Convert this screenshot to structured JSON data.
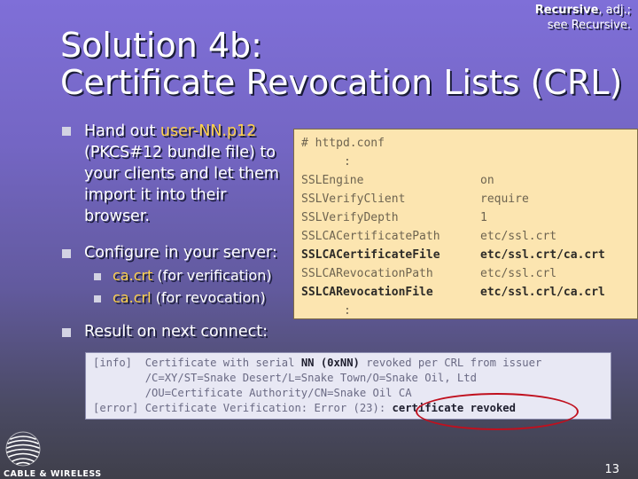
{
  "quote": {
    "word": "Recursive",
    "suffix": ", adj.;",
    "line2": "see Recursive."
  },
  "title": {
    "line1": "Solution 4b:",
    "line2": "Certificate Revocation Lists (CRL)"
  },
  "bullets": {
    "b1": {
      "prefix": "Hand out ",
      "highlight": "user-NN.p12",
      "l2": "(PKCS#12 bundle file) to",
      "l3": "your clients and let them",
      "l4": "import it into their",
      "l5": "browser."
    },
    "b2": {
      "text": "Configure in your server:"
    },
    "sub1": {
      "file": "ca.crt",
      "note": " (for verification)"
    },
    "sub2": {
      "file": "ca.crl",
      "note": " (for revocation)"
    },
    "b3": {
      "text": "Result on next connect:"
    }
  },
  "config": {
    "header": "# httpd.conf",
    "ellipsis": ":",
    "rows": [
      {
        "key": "SSLEngine",
        "value": "on"
      },
      {
        "key": "SSLVerifyClient",
        "value": "require"
      },
      {
        "key": "SSLVerifyDepth",
        "value": "1"
      },
      {
        "key": "SSLCACertificatePath",
        "value": "etc/ssl.crt"
      },
      {
        "key": "SSLCACertificateFile",
        "value": "etc/ssl.crt/ca.crt"
      },
      {
        "key": "SSLCARevocationPath",
        "value": "etc/ssl.crl"
      },
      {
        "key": "SSLCARevocationFile",
        "value": "etc/ssl.crl/ca.crl"
      }
    ]
  },
  "log": {
    "l1_tag": "[info]  ",
    "l1_a": "Certificate with serial ",
    "l1_nn": "NN",
    "l1_sp": " ",
    "l1_hex": "(0xNN)",
    "l1_b": " revoked per CRL from issuer",
    "l2": "        /C=XY/ST=Snake Desert/L=Snake Town/O=Snake Oil, Ltd",
    "l3": "        /OU=Certificate Authority/CN=Snake Oil CA",
    "l4_a": "[error] Certificate Verification: Error (23)",
    "l4_colon": ": ",
    "l4_b": "certificate revoked"
  },
  "footer": {
    "company": "CABLE & WIRELESS",
    "page": "13"
  },
  "colors": {
    "highlight": "#ffd24a",
    "config_bg": "#fce5b0",
    "log_bg": "#e8e8f4",
    "annotation": "#c0101e"
  }
}
